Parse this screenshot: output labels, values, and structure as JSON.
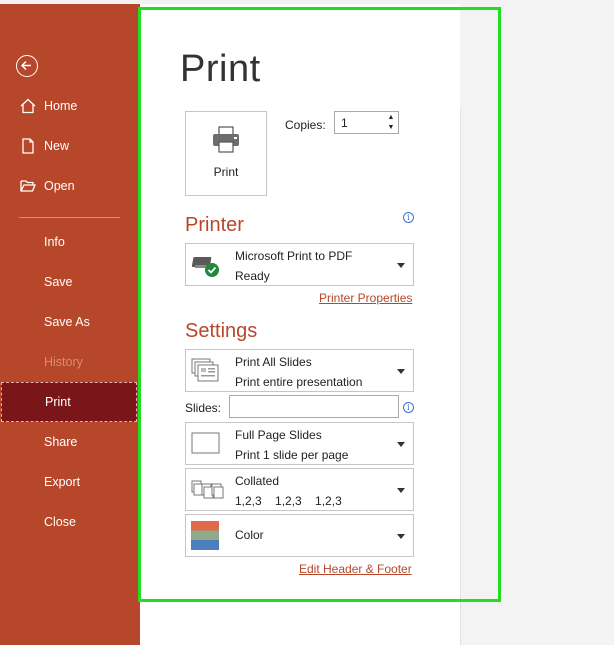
{
  "sidebar": {
    "items": [
      {
        "label": "Home"
      },
      {
        "label": "New"
      },
      {
        "label": "Open"
      },
      {
        "label": "Info"
      },
      {
        "label": "Save"
      },
      {
        "label": "Save As"
      },
      {
        "label": "History"
      },
      {
        "label": "Print"
      },
      {
        "label": "Share"
      },
      {
        "label": "Export"
      },
      {
        "label": "Close"
      }
    ]
  },
  "main": {
    "title": "Print",
    "print_button_label": "Print",
    "copies_label": "Copies:",
    "copies_value": "1",
    "printer_heading": "Printer",
    "printer_name": "Microsoft Print to PDF",
    "printer_status": "Ready",
    "printer_properties_link": "Printer Properties",
    "settings_heading": "Settings",
    "slides_range_main": "Print All Slides",
    "slides_range_sub": "Print entire presentation",
    "slides_label": "Slides:",
    "slides_value": "",
    "layout_main": "Full Page Slides",
    "layout_sub": "Print 1 slide per page",
    "collation_main": "Collated",
    "collation_sub": "1,2,3    1,2,3    1,2,3",
    "color_main": "Color",
    "edit_header_footer_link": "Edit Header & Footer"
  },
  "colors": {
    "accent": "#b7472a",
    "selected_nav": "#7a1519",
    "highlight_frame": "#22dd22"
  },
  "icons": {
    "back": "back-arrow-icon",
    "home": "home-icon",
    "new": "new-document-icon",
    "open": "open-folder-icon",
    "printer": "printer-icon",
    "printer_ready": "printer-ready-icon",
    "info": "info-icon"
  }
}
